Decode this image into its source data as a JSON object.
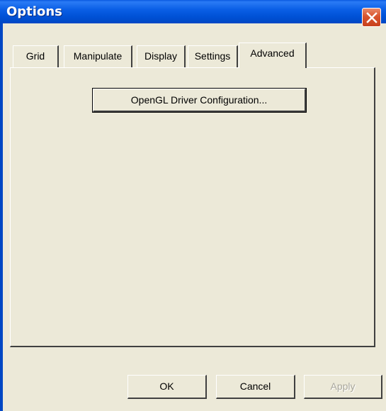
{
  "window": {
    "title": "Options"
  },
  "tabs": [
    {
      "label": "Grid",
      "active": false
    },
    {
      "label": "Manipulate",
      "active": false
    },
    {
      "label": "Display",
      "active": false
    },
    {
      "label": "Settings",
      "active": false
    },
    {
      "label": "Advanced",
      "active": true
    }
  ],
  "advanced_panel": {
    "opengl_button_label": "OpenGL Driver Configuration..."
  },
  "footer": {
    "ok_label": "OK",
    "cancel_label": "Cancel",
    "apply_label": "Apply",
    "apply_enabled": false
  },
  "colors": {
    "titlebar": "#0a5be3",
    "dialog_face": "#ece9d8",
    "close_button": "#d9542e"
  },
  "icons": {
    "close": "close-x-icon"
  }
}
